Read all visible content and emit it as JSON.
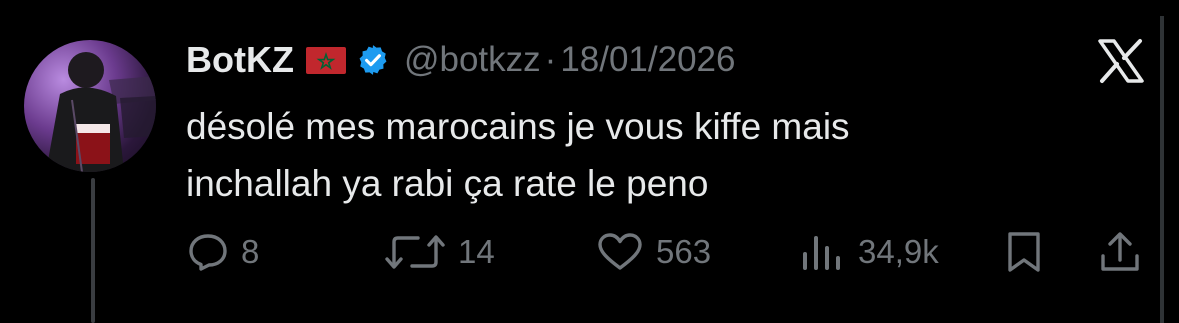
{
  "tweet": {
    "display_name": "BotKZ",
    "handle": "@botkzz",
    "separator": "·",
    "date": "18/01/2026",
    "text_lines": [
      "désolé mes marocains je vous kiffe mais",
      "inchallah ya rabi ça rate le peno"
    ]
  },
  "badges": {
    "flag_icon": "morocco-flag-icon",
    "verified_icon": "verified-badge-icon",
    "brand_icon": "x-logo-icon"
  },
  "actions": {
    "reply_count": "8",
    "retweet_count": "14",
    "like_count": "563",
    "views_count": "34,9k"
  },
  "colors": {
    "background": "#000000",
    "text": "#e7e9ea",
    "muted": "#71767b",
    "verified_blue": "#1d9bf0",
    "flag_red": "#c1272d",
    "flag_green": "#006233"
  }
}
